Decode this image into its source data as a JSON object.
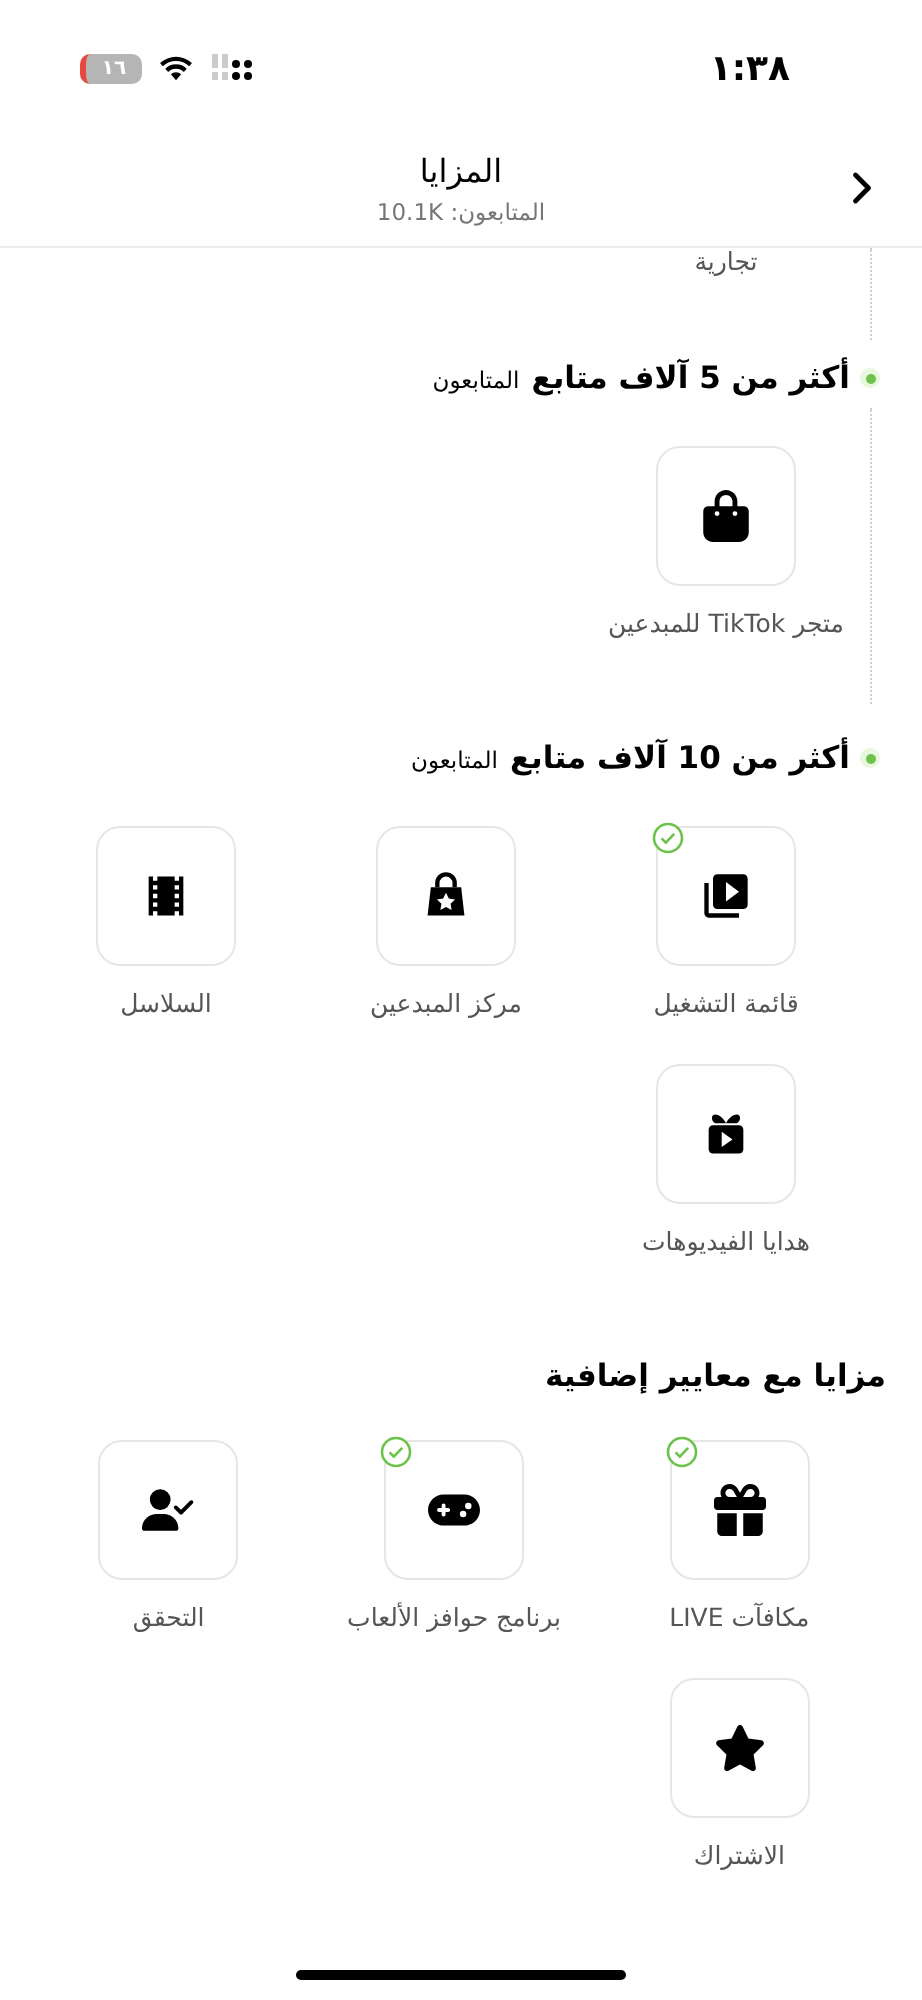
{
  "status_bar": {
    "time": "١:٣٨",
    "battery": "١٦"
  },
  "header": {
    "title": "المزايا",
    "subtitle": "المتابعون: 10.1K"
  },
  "cut_label": "تجارية",
  "sections": [
    {
      "kind": "milestone",
      "title": "أكثر من 5 آلاف متابع",
      "suffix": "المتابعون",
      "items": [
        {
          "label": "متجر TikTok للمبدعين",
          "unlocked": false
        }
      ]
    },
    {
      "kind": "milestone",
      "title": "أكثر من 10 آلاف متابع",
      "suffix": "المتابعون",
      "items": [
        {
          "label": "قائمة التشغيل",
          "unlocked": true
        },
        {
          "label": "مركز المبدعين",
          "unlocked": false
        },
        {
          "label": "السلاسل",
          "unlocked": false
        },
        {
          "label": "هدايا الفيديوهات",
          "unlocked": false
        }
      ]
    },
    {
      "kind": "plain",
      "title": "مزايا مع معايير إضافية",
      "items": [
        {
          "label": "مكافآت LIVE",
          "unlocked": true
        },
        {
          "label": "برنامج حوافز الألعاب",
          "unlocked": true
        },
        {
          "label": "التحقق",
          "unlocked": false
        },
        {
          "label": "الاشتراك",
          "unlocked": false
        }
      ]
    }
  ]
}
